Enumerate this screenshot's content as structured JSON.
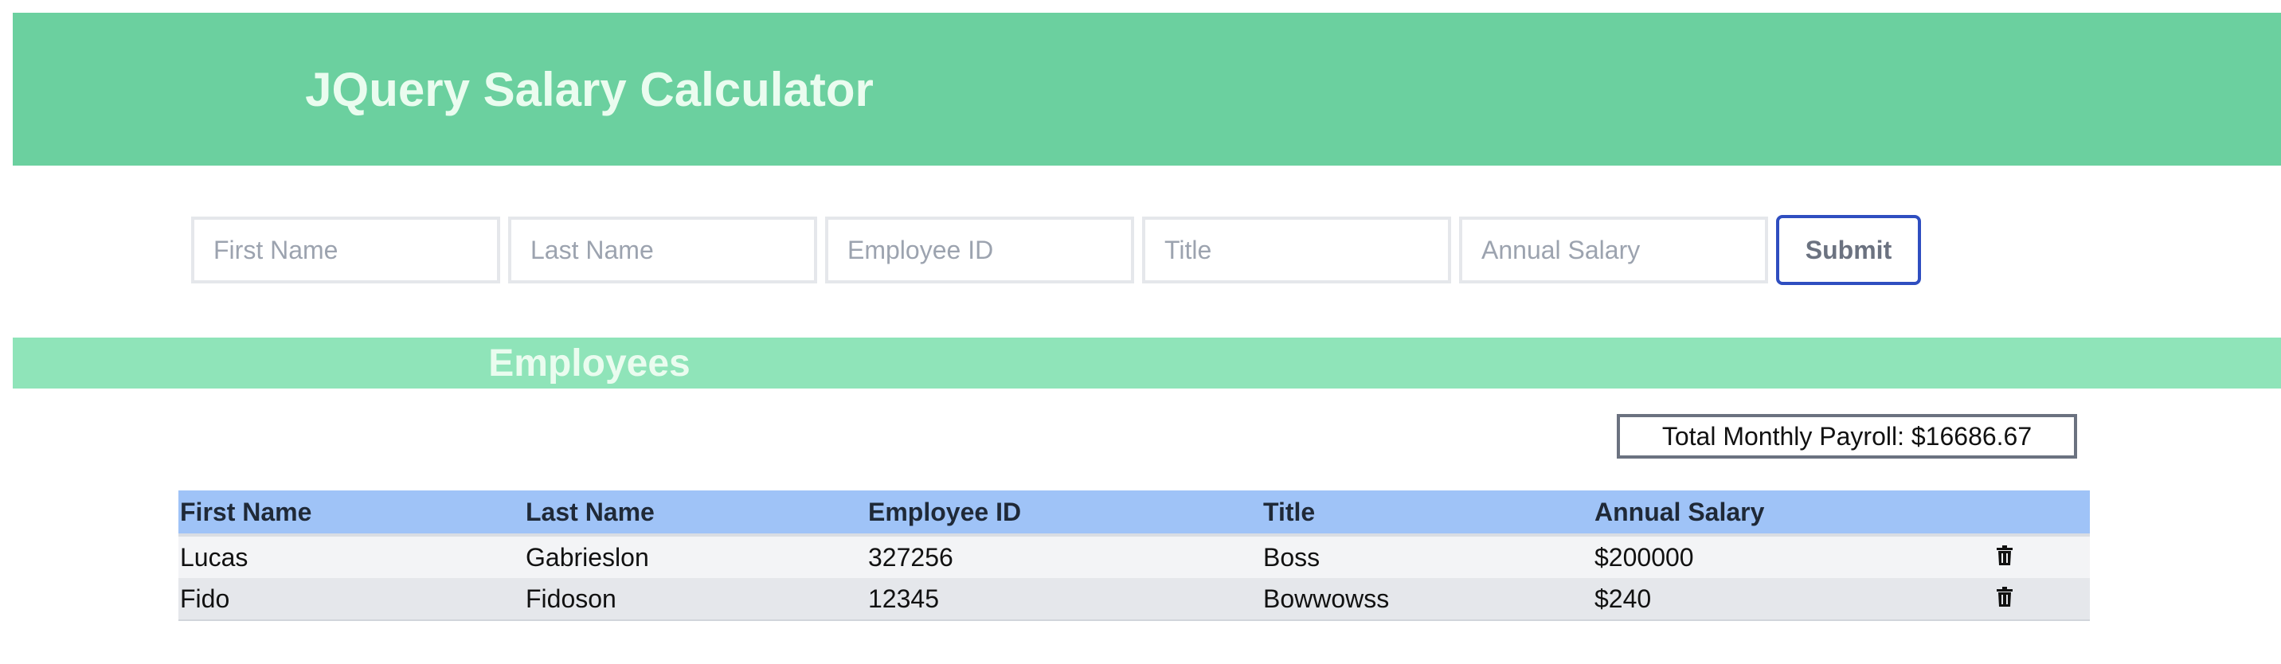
{
  "header": {
    "title": "JQuery Salary Calculator"
  },
  "form": {
    "first_name_placeholder": "First Name",
    "last_name_placeholder": "Last Name",
    "employee_id_placeholder": "Employee ID",
    "title_placeholder": "Title",
    "annual_salary_placeholder": "Annual Salary",
    "submit_label": "Submit"
  },
  "section": {
    "title": "Employees"
  },
  "payroll": {
    "text": "Total Monthly Payroll: $16686.67"
  },
  "table": {
    "headers": [
      "First Name",
      "Last Name",
      "Employee ID",
      "Title",
      "Annual Salary"
    ],
    "rows": [
      [
        "Lucas",
        "Gabrieslon",
        "327256",
        "Boss",
        "$200000"
      ],
      [
        "Fido",
        "Fidoson",
        "12345",
        "Bowwowss",
        "$240"
      ]
    ]
  },
  "colors": {
    "header_bg": "#6bd09f",
    "section_bg": "#8fe4b9",
    "table_header_bg": "#9fc3f7",
    "submit_border": "#2f4ec0"
  },
  "icons": {
    "delete": "trash-icon"
  }
}
